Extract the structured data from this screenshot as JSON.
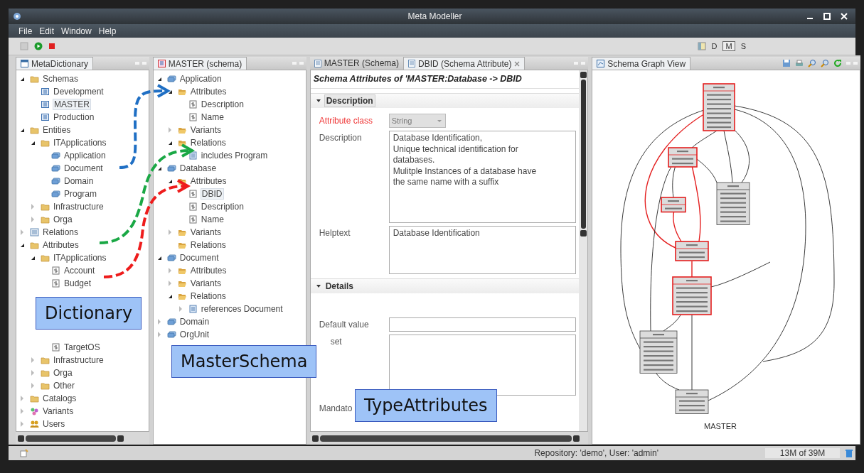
{
  "window": {
    "title": "Meta Modeller"
  },
  "menu": [
    "File",
    "Edit",
    "Window",
    "Help"
  ],
  "perspectives": [
    {
      "label": "D",
      "selected": false
    },
    {
      "label": "M",
      "selected": true
    },
    {
      "label": "S",
      "selected": false
    }
  ],
  "left_pane": {
    "title": "MetaDictionary",
    "tree": [
      {
        "label": "Schemas",
        "kind": "folder",
        "expanded": true,
        "selected": false,
        "children": [
          {
            "label": "Development",
            "kind": "schema",
            "selected": false
          },
          {
            "label": "MASTER",
            "kind": "schema",
            "selected": true
          },
          {
            "label": "Production",
            "kind": "schema",
            "selected": false
          }
        ]
      },
      {
        "label": "Entities",
        "kind": "folder",
        "expanded": true,
        "selected": false,
        "children": [
          {
            "label": "ITApplications",
            "kind": "folder",
            "expanded": true,
            "selected": false,
            "children": [
              {
                "label": "Application",
                "kind": "entity",
                "selected": false
              },
              {
                "label": "Document",
                "kind": "entity",
                "selected": false
              },
              {
                "label": "Domain",
                "kind": "entity",
                "selected": false
              },
              {
                "label": "Program",
                "kind": "entity",
                "selected": false
              }
            ]
          },
          {
            "label": "Infrastructure",
            "kind": "folder",
            "expanded": false,
            "selected": false
          },
          {
            "label": "Orga",
            "kind": "folder",
            "expanded": false,
            "selected": false
          }
        ]
      },
      {
        "label": "Relations",
        "kind": "list",
        "expanded": false,
        "selected": false
      },
      {
        "label": "Attributes",
        "kind": "folder",
        "expanded": true,
        "selected": false,
        "children": [
          {
            "label": "ITApplications",
            "kind": "folder",
            "expanded": true,
            "selected": false,
            "children": [
              {
                "label": "Account",
                "kind": "attribute",
                "selected": false
              },
              {
                "label": "Budget",
                "kind": "attribute",
                "selected": false
              },
              {
                "kind": "covered"
              },
              {
                "kind": "covered"
              },
              {
                "kind": "covered"
              },
              {
                "kind": "covered"
              },
              {
                "label": "TargetOS",
                "kind": "attribute",
                "selected": false
              }
            ]
          },
          {
            "label": "Infrastructure",
            "kind": "folder",
            "expanded": false,
            "selected": false
          },
          {
            "label": "Orga",
            "kind": "folder",
            "expanded": false,
            "selected": false
          },
          {
            "label": "Other",
            "kind": "folder",
            "expanded": false,
            "selected": false
          }
        ]
      },
      {
        "label": "Catalogs",
        "kind": "folder",
        "expanded": false,
        "selected": false
      },
      {
        "label": "Variants",
        "kind": "variants",
        "expanded": false,
        "selected": false
      },
      {
        "label": "Users",
        "kind": "users",
        "expanded": false,
        "selected": false
      }
    ]
  },
  "master_pane": {
    "title": "MASTER (schema)",
    "tree": [
      {
        "label": "Application",
        "kind": "entity",
        "expanded": true,
        "selected": false,
        "children": [
          {
            "label": "Attributes",
            "kind": "openfolder",
            "expanded": true,
            "selected": false,
            "children": [
              {
                "label": "Description",
                "kind": "attribute",
                "selected": false
              },
              {
                "label": "Name",
                "kind": "attribute",
                "selected": false
              }
            ]
          },
          {
            "label": "Variants",
            "kind": "openfolder",
            "expanded": false,
            "selected": false
          },
          {
            "label": "Relations",
            "kind": "openfolder",
            "expanded": true,
            "selected": false,
            "children": [
              {
                "label": "includes Program",
                "kind": "relation",
                "selected": false
              }
            ]
          }
        ]
      },
      {
        "label": "Database",
        "kind": "entity",
        "expanded": true,
        "selected": false,
        "children": [
          {
            "label": "Attributes",
            "kind": "openfolder",
            "expanded": true,
            "selected": false,
            "children": [
              {
                "label": "DBID",
                "kind": "attribute",
                "selected": true
              },
              {
                "label": "Description",
                "kind": "attribute",
                "selected": false
              },
              {
                "label": "Name",
                "kind": "attribute",
                "selected": false
              }
            ]
          },
          {
            "label": "Variants",
            "kind": "openfolder",
            "expanded": false,
            "selected": false
          },
          {
            "label": "Relations",
            "kind": "openfolder",
            "selected": false
          }
        ]
      },
      {
        "label": "Document",
        "kind": "entity",
        "expanded": true,
        "selected": false,
        "children": [
          {
            "label": "Attributes",
            "kind": "openfolder",
            "expanded": false,
            "selected": false
          },
          {
            "label": "Variants",
            "kind": "openfolder",
            "expanded": false,
            "selected": false
          },
          {
            "label": "Relations",
            "kind": "openfolder",
            "expanded": true,
            "selected": false,
            "children": [
              {
                "label": "references Document",
                "kind": "relation",
                "expanded": false,
                "selected": false
              }
            ]
          }
        ]
      },
      {
        "label": "Domain",
        "kind": "entity",
        "expanded": false,
        "selected": false
      },
      {
        "label": "OrgUnit",
        "kind": "entity",
        "expanded": false,
        "selected": false
      },
      {
        "kind": "covered"
      },
      {
        "kind": "covered"
      },
      {
        "kind": "covered"
      }
    ]
  },
  "editor": {
    "tabs": [
      {
        "label": "MASTER (Schema)",
        "selected": false
      },
      {
        "label": "DBID (Schema Attribute)",
        "selected": true
      }
    ],
    "heading": "Schema Attributes of 'MASTER:Database -> DBID",
    "sections": [
      {
        "title": "Description",
        "expanded": true,
        "fields": [
          {
            "label": "Attribute class",
            "kind": "combo",
            "required": true,
            "value": "String",
            "disabled": true
          },
          {
            "label": "Description",
            "kind": "textarea",
            "value": "Database Identification,\nUnique technical identification for\ndatabases.\nMulitple Instances of a database have\nthe same name with a suffix"
          },
          {
            "label": "Helptext",
            "kind": "textarea",
            "value": "Database Identification"
          }
        ]
      },
      {
        "title": "Details",
        "expanded": true,
        "fields": [
          {
            "label": "Default value",
            "kind": "input"
          },
          {
            "label": "set",
            "kind": "list",
            "covered": true
          },
          {
            "label": "Mandato",
            "kind": "check"
          }
        ]
      }
    ]
  },
  "graph_pane": {
    "title": "Schema Graph View",
    "caption": "MASTER",
    "nodes": [
      {
        "highlighted": true
      },
      {
        "highlighted": true
      },
      {
        "highlighted": true
      },
      {
        "highlighted": false
      },
      {
        "highlighted": true
      },
      {
        "highlighted": true
      },
      {
        "highlighted": false
      },
      {
        "highlighted": false
      }
    ]
  },
  "status_bar": {
    "repository": "Repository: 'demo', User: 'admin'",
    "memory": "13M of 39M"
  },
  "annotations": {
    "callouts": [
      "Dictionary",
      "MasterSchema",
      "TypeAttributes"
    ],
    "arrows": [
      {
        "color": "#1f6fc4"
      },
      {
        "color": "#1aa845"
      },
      {
        "color": "#ee1c1c"
      }
    ]
  }
}
